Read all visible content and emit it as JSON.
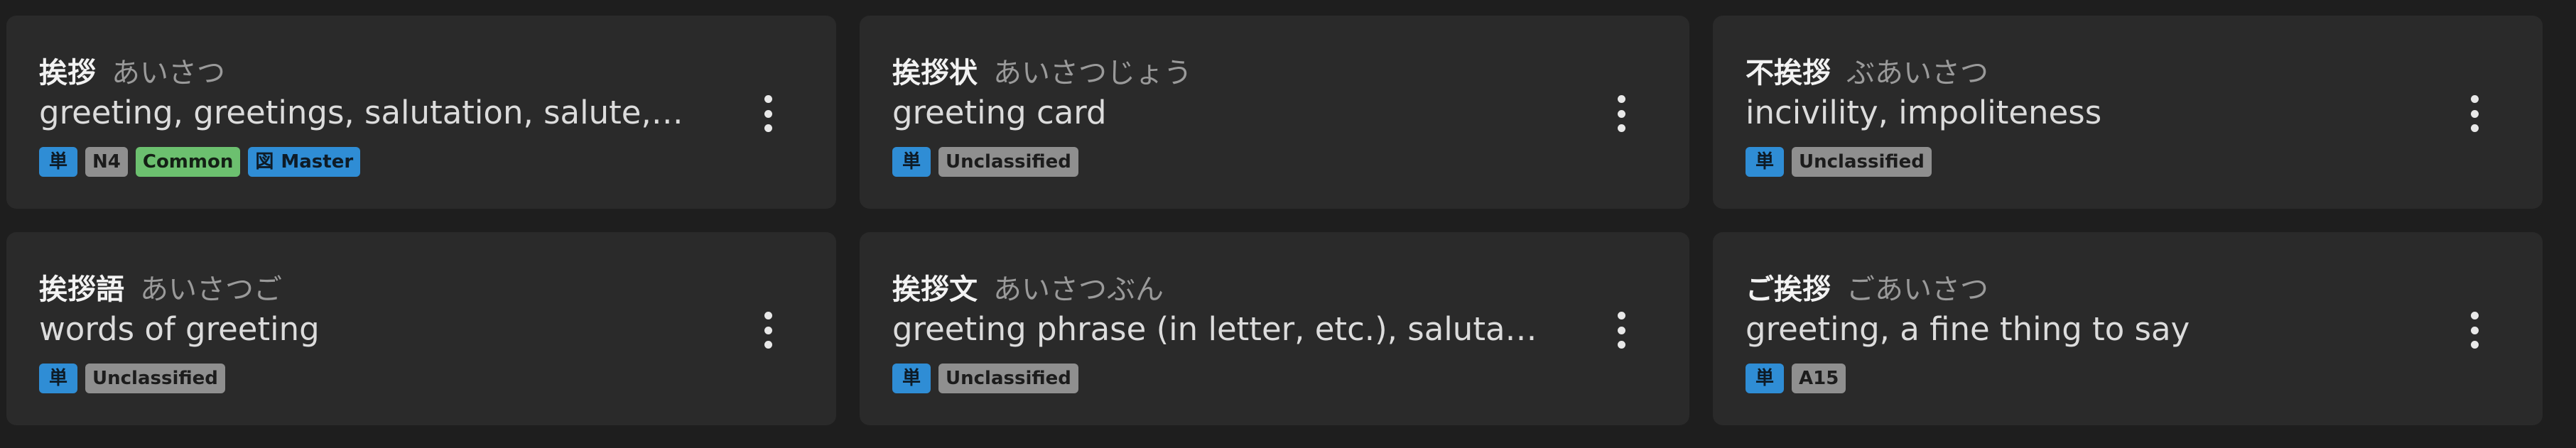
{
  "cards": [
    {
      "word": "挨拶",
      "reading": "あいさつ",
      "meaning": "greeting, greetings, salutation, salute,…",
      "tags": [
        {
          "label": "単",
          "style": "kind"
        },
        {
          "label": "N4",
          "style": "gray"
        },
        {
          "label": "Common",
          "style": "green"
        },
        {
          "label": "Master",
          "style": "blue",
          "icon": "図"
        }
      ]
    },
    {
      "word": "挨拶状",
      "reading": "あいさつじょう",
      "meaning": "greeting card",
      "tags": [
        {
          "label": "単",
          "style": "kind"
        },
        {
          "label": "Unclassified",
          "style": "gray"
        }
      ]
    },
    {
      "word": "不挨拶",
      "reading": "ぶあいさつ",
      "meaning": "incivility, impoliteness",
      "tags": [
        {
          "label": "単",
          "style": "kind"
        },
        {
          "label": "Unclassified",
          "style": "gray"
        }
      ]
    },
    {
      "word": "挨拶語",
      "reading": "あいさつご",
      "meaning": "words of greeting",
      "tags": [
        {
          "label": "単",
          "style": "kind"
        },
        {
          "label": "Unclassified",
          "style": "gray"
        }
      ]
    },
    {
      "word": "挨拶文",
      "reading": "あいさつぶん",
      "meaning": "greeting phrase (in letter, etc.), salutation",
      "tags": [
        {
          "label": "単",
          "style": "kind"
        },
        {
          "label": "Unclassified",
          "style": "gray"
        }
      ]
    },
    {
      "word": "ご挨拶",
      "reading": "ごあいさつ",
      "meaning": "greeting, a fine thing to say",
      "tags": [
        {
          "label": "単",
          "style": "kind"
        },
        {
          "label": "A15",
          "style": "gray"
        }
      ]
    }
  ]
}
